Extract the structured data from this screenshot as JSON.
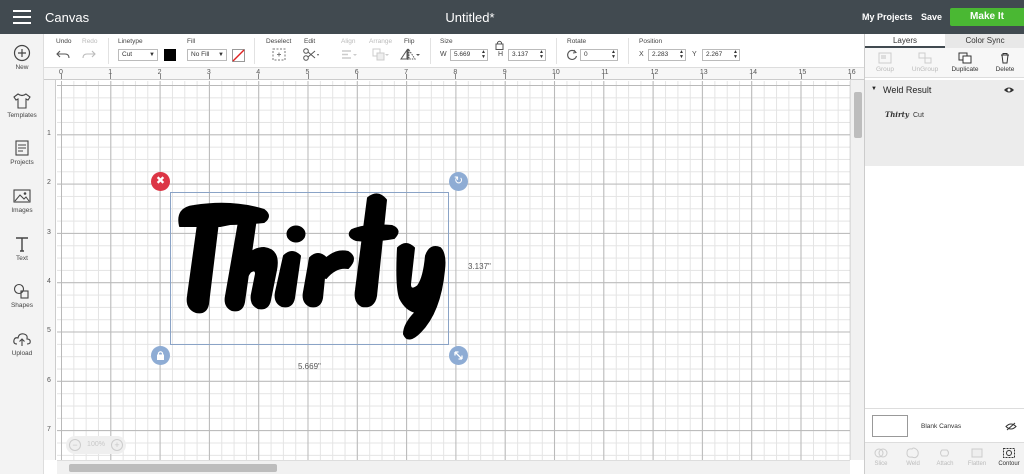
{
  "topbar": {
    "app_title": "Canvas",
    "doc_title": "Untitled*",
    "my_projects": "My Projects",
    "save": "Save",
    "make_it": "Make It"
  },
  "sidebar": {
    "items": [
      {
        "label": "New",
        "icon": "plus-circle-icon"
      },
      {
        "label": "Templates",
        "icon": "shirt-icon"
      },
      {
        "label": "Projects",
        "icon": "projects-icon"
      },
      {
        "label": "Images",
        "icon": "image-icon"
      },
      {
        "label": "Text",
        "icon": "text-icon"
      },
      {
        "label": "Shapes",
        "icon": "shapes-icon"
      },
      {
        "label": "Upload",
        "icon": "upload-cloud-icon"
      }
    ]
  },
  "toolbar": {
    "undo": "Undo",
    "redo": "Redo",
    "linetype_label": "Linetype",
    "linetype_value": "Cut",
    "fill_label": "Fill",
    "fill_value": "No Fill",
    "deselect": "Deselect",
    "edit": "Edit",
    "align": "Align",
    "arrange": "Arrange",
    "flip": "Flip",
    "size_label": "Size",
    "w_prefix": "W",
    "w_value": "5.669",
    "h_prefix": "H",
    "h_value": "3.137",
    "rotate_label": "Rotate",
    "rotate_value": "0",
    "position_label": "Position",
    "x_prefix": "X",
    "x_value": "2.283",
    "y_prefix": "Y",
    "y_value": "2.267",
    "linetype_color": "#000000"
  },
  "rulers": {
    "top": [
      "0",
      "1",
      "2",
      "3",
      "4",
      "5",
      "6",
      "7",
      "8",
      "9",
      "10",
      "11",
      "12",
      "13",
      "14",
      "15",
      "16"
    ],
    "left": [
      "1",
      "2",
      "3",
      "4",
      "5",
      "6",
      "7"
    ]
  },
  "canvas": {
    "zoom": "100%",
    "dim_width": "5.669\"",
    "dim_height": "3.137\"",
    "art_text": "Thirty"
  },
  "panel": {
    "tabs": [
      "Layers",
      "Color Sync"
    ],
    "actions": [
      {
        "label": "Group",
        "enabled": false
      },
      {
        "label": "UnGroup",
        "enabled": false
      },
      {
        "label": "Duplicate",
        "enabled": true
      },
      {
        "label": "Delete",
        "enabled": true
      }
    ],
    "group_name": "Weld Result",
    "layer_thumb": "Thirty",
    "layer_name": "Cut",
    "blank_canvas": "Blank Canvas",
    "bottom_actions": [
      {
        "label": "Slice",
        "enabled": false
      },
      {
        "label": "Weld",
        "enabled": false
      },
      {
        "label": "Attach",
        "enabled": false
      },
      {
        "label": "Flatten",
        "enabled": false
      },
      {
        "label": "Contour",
        "enabled": true
      }
    ]
  }
}
